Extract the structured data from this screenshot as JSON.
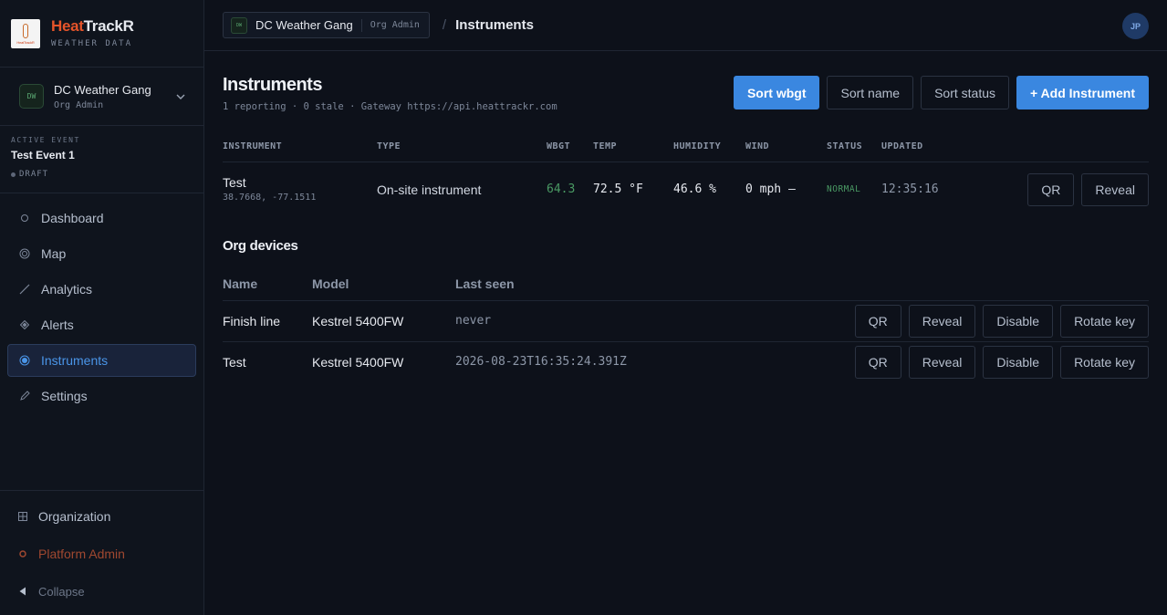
{
  "brand": {
    "name_a": "Heat",
    "name_b": "TrackR",
    "subtitle": "WEATHER DATA",
    "logo_text": "HeatTrackR"
  },
  "org": {
    "badge": "DW",
    "name": "DC Weather Gang",
    "role": "Org Admin"
  },
  "event": {
    "label": "ACTIVE EVENT",
    "name": "Test Event 1",
    "status": "DRAFT"
  },
  "nav": {
    "dashboard": "Dashboard",
    "map": "Map",
    "analytics": "Analytics",
    "alerts": "Alerts",
    "instruments": "Instruments",
    "settings": "Settings"
  },
  "bottom": {
    "organization": "Organization",
    "platform_admin": "Platform Admin",
    "collapse": "Collapse"
  },
  "topbar": {
    "org_badge": "DW",
    "org_name": "DC Weather Gang",
    "org_role": "Org Admin",
    "separator": "/",
    "current": "Instruments",
    "avatar": "JP"
  },
  "page": {
    "title": "Instruments",
    "subtitle": "1 reporting · 0 stale · Gateway https://api.heattrackr.com",
    "sort_wbgt": "Sort wbgt",
    "sort_name": "Sort name",
    "sort_status": "Sort status",
    "add_instrument": "+ Add Instrument"
  },
  "instruments": {
    "headers": {
      "instrument": "INSTRUMENT",
      "type": "TYPE",
      "wbgt": "WBGT",
      "temp": "TEMP",
      "humidity": "HUMIDITY",
      "wind": "WIND",
      "status": "STATUS",
      "updated": "UPDATED"
    },
    "rows": [
      {
        "name": "Test",
        "coords": "38.7668, -77.1511",
        "type": "On-site instrument",
        "wbgt": "64.3",
        "temp": "72.5 °F",
        "humidity": "46.6 %",
        "wind": "0 mph —",
        "status": "NORMAL",
        "updated": "12:35:16",
        "qr": "QR",
        "reveal": "Reveal"
      }
    ]
  },
  "devices": {
    "title": "Org devices",
    "headers": {
      "name": "Name",
      "model": "Model",
      "last_seen": "Last seen"
    },
    "rows": [
      {
        "name": "Finish line",
        "model": "Kestrel 5400FW",
        "last_seen": "never",
        "qr": "QR",
        "reveal": "Reveal",
        "disable": "Disable",
        "rotate": "Rotate key"
      },
      {
        "name": "Test",
        "model": "Kestrel 5400FW",
        "last_seen": "2026-08-23T16:35:24.391Z",
        "qr": "QR",
        "reveal": "Reveal",
        "disable": "Disable",
        "rotate": "Rotate key"
      }
    ]
  },
  "colors": {
    "accent": "#3a87e0",
    "brand": "#e6542a",
    "status_ok": "#4a9a64",
    "background": "#0d111a"
  }
}
